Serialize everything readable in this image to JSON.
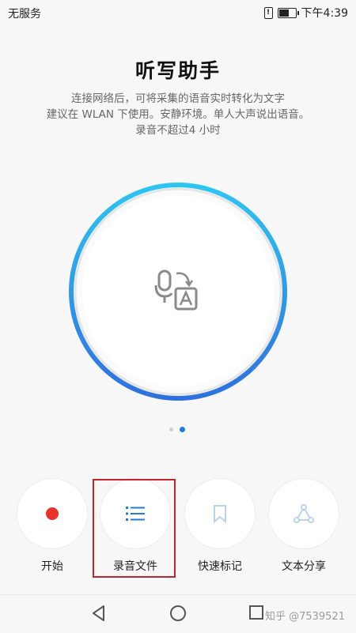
{
  "status_bar": {
    "carrier": "无服务",
    "sim_badge": "!",
    "time": "下午4:39",
    "battery_level": 0.6
  },
  "header": {
    "title": "听写助手",
    "description_lines": [
      "连接网络后，可将采集的语音实时转化为文字",
      "建议在 WLAN 下使用。安静环境。单人大声说出语音。",
      "录音不超过4 小时"
    ]
  },
  "main": {
    "dial_icon": "voice-to-text-icon",
    "pager": {
      "count": 2,
      "active_index": 1
    }
  },
  "actions": [
    {
      "label": "开始",
      "icon": "record-icon",
      "color": "#e8312b"
    },
    {
      "label": "录音文件",
      "icon": "list-icon",
      "color": "#1e7be0"
    },
    {
      "label": "快速标记",
      "icon": "bookmark-icon",
      "color": "#b9d3ef"
    },
    {
      "label": "文本分享",
      "icon": "share-icon",
      "color": "#b9d3ef"
    }
  ],
  "nav": {
    "back_icon": "back-icon",
    "home_icon": "home-icon",
    "recents_icon": "recents-icon",
    "watermark": "知乎 @7539521"
  },
  "colors": {
    "accent": "#1e7be0",
    "dial_gradient_start": "#2ec6f3",
    "dial_gradient_end": "#2f6fe0",
    "highlight": "#c8242e"
  }
}
